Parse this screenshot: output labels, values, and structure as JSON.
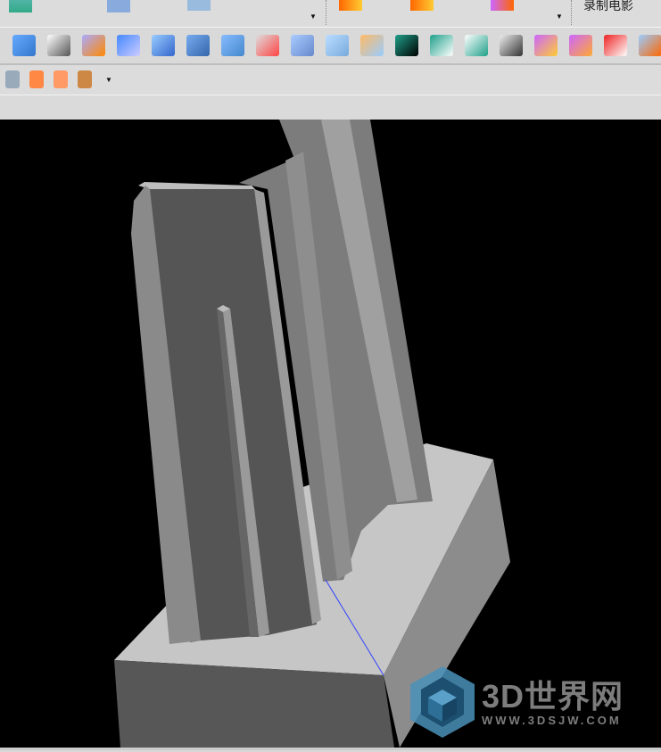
{
  "toolbar_top": {
    "record_movie_label": "录制电影"
  },
  "toolbar_main": {
    "icons": [
      "extrude-icon",
      "offset-region-icon",
      "emboss-icon",
      "pattern-face-icon",
      "replace-face-icon",
      "draft-body-icon",
      "thicken-icon",
      "sweep-icon",
      "split-body-icon",
      "move-body-icon",
      "trim-body-icon",
      "divide-face-icon",
      "unite-icon",
      "subtract-icon",
      "intersect-icon",
      "dimension-icon",
      "synchronous-icon",
      "delete-body-icon",
      "red-box-icon",
      "split-face-icon"
    ]
  },
  "toolbar_third": {
    "icons": [
      "point-icon",
      "rotate-icon",
      "snap-icon",
      "assembly-icon"
    ]
  },
  "watermark": {
    "title": "3D世界网",
    "url": "WWW.3DSJW.COM"
  },
  "colors": {
    "viewport_bg": "#000000",
    "toolbar_bg": "#dcdcdc",
    "accent_teal": "#1fa08a"
  }
}
